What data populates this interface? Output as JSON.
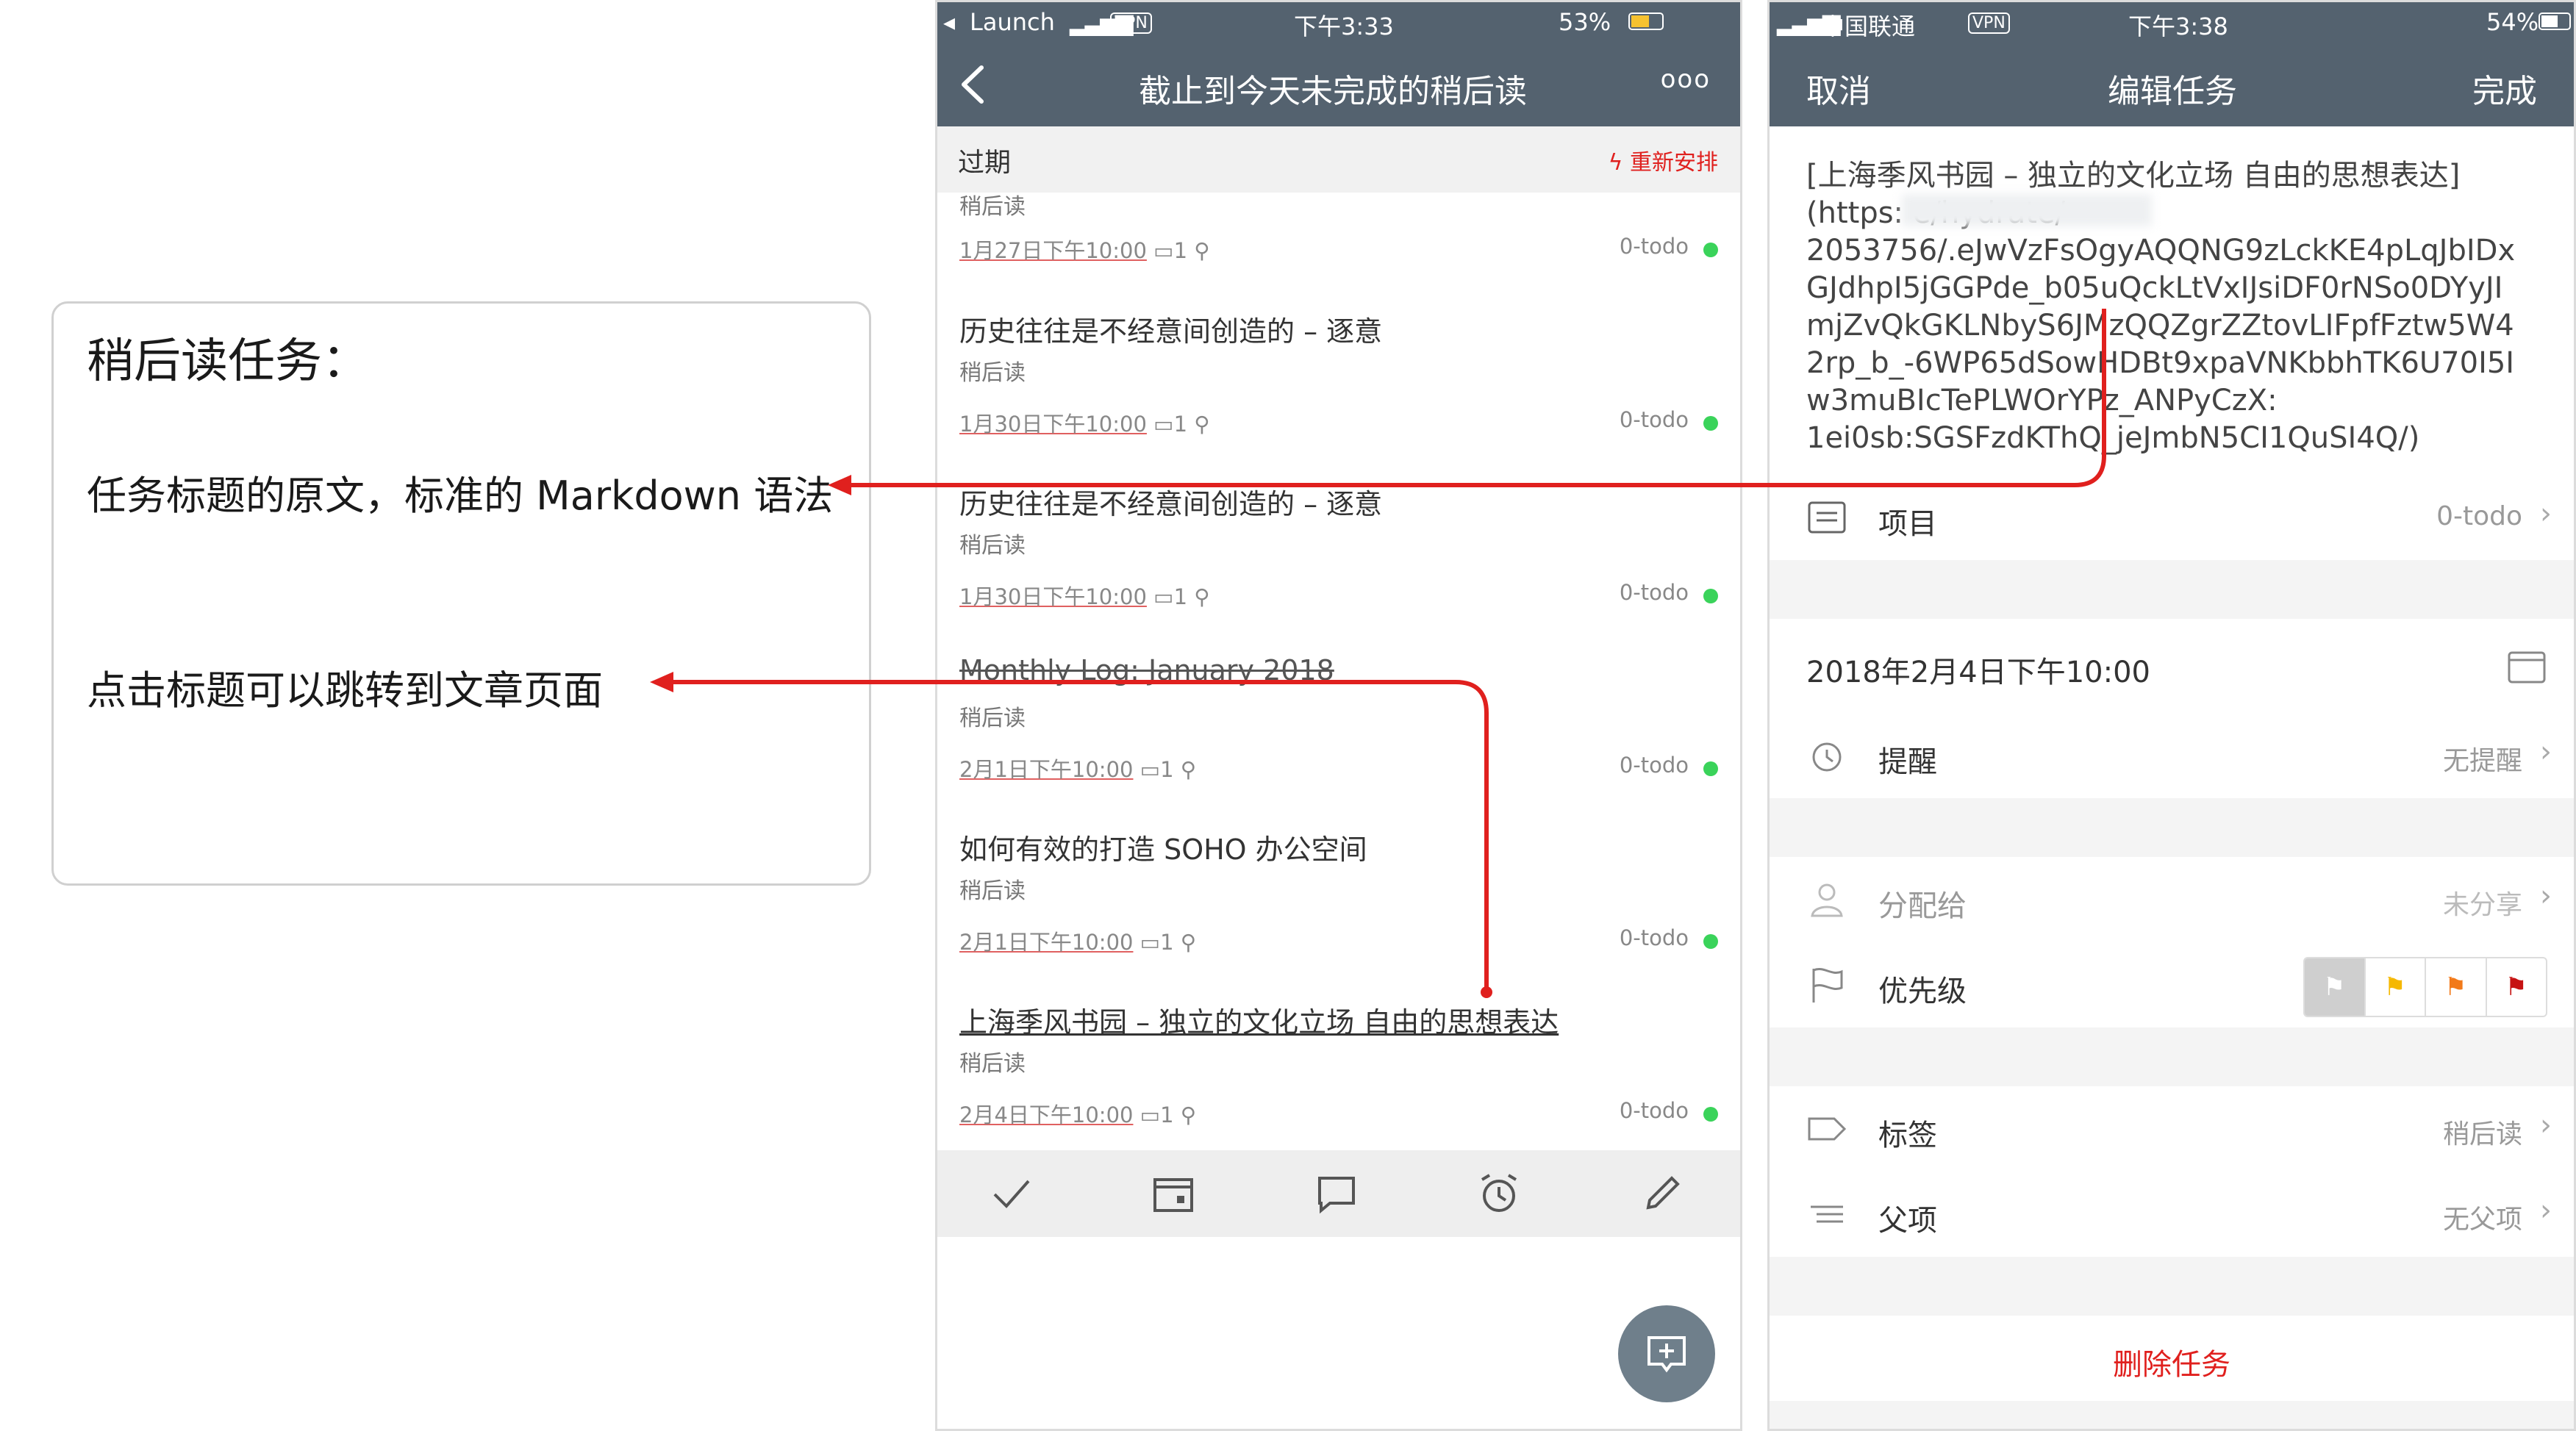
{
  "annotation": {
    "heading": "稍后读任务：",
    "line1": "任务标题的原文，标准的 Markdown 语法",
    "line2": "点击标题可以跳转到文章页面"
  },
  "phone1": {
    "status": {
      "carrier": "Launch",
      "vpn": "VPN",
      "time": "下午3:33",
      "battery": "53%"
    },
    "nav": {
      "title": "截止到今天未完成的稍后读",
      "more": "ooo"
    },
    "section": {
      "title": "过期",
      "action": "重新安排"
    },
    "partial_row": {
      "sub": "稍后读",
      "date": "1月27日下午10:00",
      "comments": "1",
      "project": "0-todo"
    },
    "rows": [
      {
        "title": "历史往往是不经意间创造的 – 逐意",
        "sub": "稍后读",
        "date": "1月30日下午10:00",
        "comments": "1",
        "project": "0-todo"
      },
      {
        "title": "历史往往是不经意间创造的 – 逐意",
        "sub": "稍后读",
        "date": "1月30日下午10:00",
        "comments": "1",
        "project": "0-todo"
      },
      {
        "title": "Monthly Log: January 2018",
        "sub": "稍后读",
        "date": "2月1日下午10:00",
        "comments": "1",
        "project": "0-todo"
      },
      {
        "title": "如何有效的打造 SOHO 办公空间",
        "sub": "稍后读",
        "date": "2月1日下午10:00",
        "comments": "1",
        "project": "0-todo"
      },
      {
        "title": "上海季风书园 – 独立的文化立场 自由的思想表达",
        "sub": "稍后读",
        "date": "2月4日下午10:00",
        "comments": "1",
        "project": "0-todo"
      }
    ]
  },
  "phone2": {
    "status": {
      "carrier": "中国联通",
      "vpn": "VPN",
      "time": "下午3:38",
      "battery": "54%"
    },
    "nav": {
      "cancel": "取消",
      "title": "编辑任务",
      "done": "完成"
    },
    "task_text_lines": [
      "[上海季风书园 – 独立的文化立场 自由的思想表达]",
      "(https:                          e/hydrate/",
      "2053756/.eJwVzFsOgyAQQNG9zLckKE4pLqJbIDx",
      "GJdhpI5jGGPde_b05uQckLtVxIJsiDF0rNSo0DYyJI",
      "mjZvQkGKLNbyS6JMzQQZgrZZtovLIFpfFztw5W4",
      "2rp_b_-6WP65dSowHDBt9xpaVNKbbhTK6U70I5I",
      "w3muBIcTePLWOrYPz_ANPyCzX:",
      "1ei0sb:SGSFzdKThQ_jeJmbN5CI1QuSI4Q/)"
    ],
    "project": {
      "label": "项目",
      "value": "0-todo"
    },
    "due": {
      "value": "2018年2月4日下午10:00"
    },
    "reminder": {
      "label": "提醒",
      "value": "无提醒"
    },
    "assign": {
      "label": "分配给",
      "value": "未分享"
    },
    "priority": {
      "label": "优先级"
    },
    "tags": {
      "label": "标签",
      "value": "稍后读"
    },
    "parent": {
      "label": "父项",
      "value": "无父项"
    },
    "delete": "删除任务"
  },
  "colors": {
    "nav_bg": "#54626f",
    "accent_red": "#e0201e",
    "done_green": "#3ad35a"
  }
}
